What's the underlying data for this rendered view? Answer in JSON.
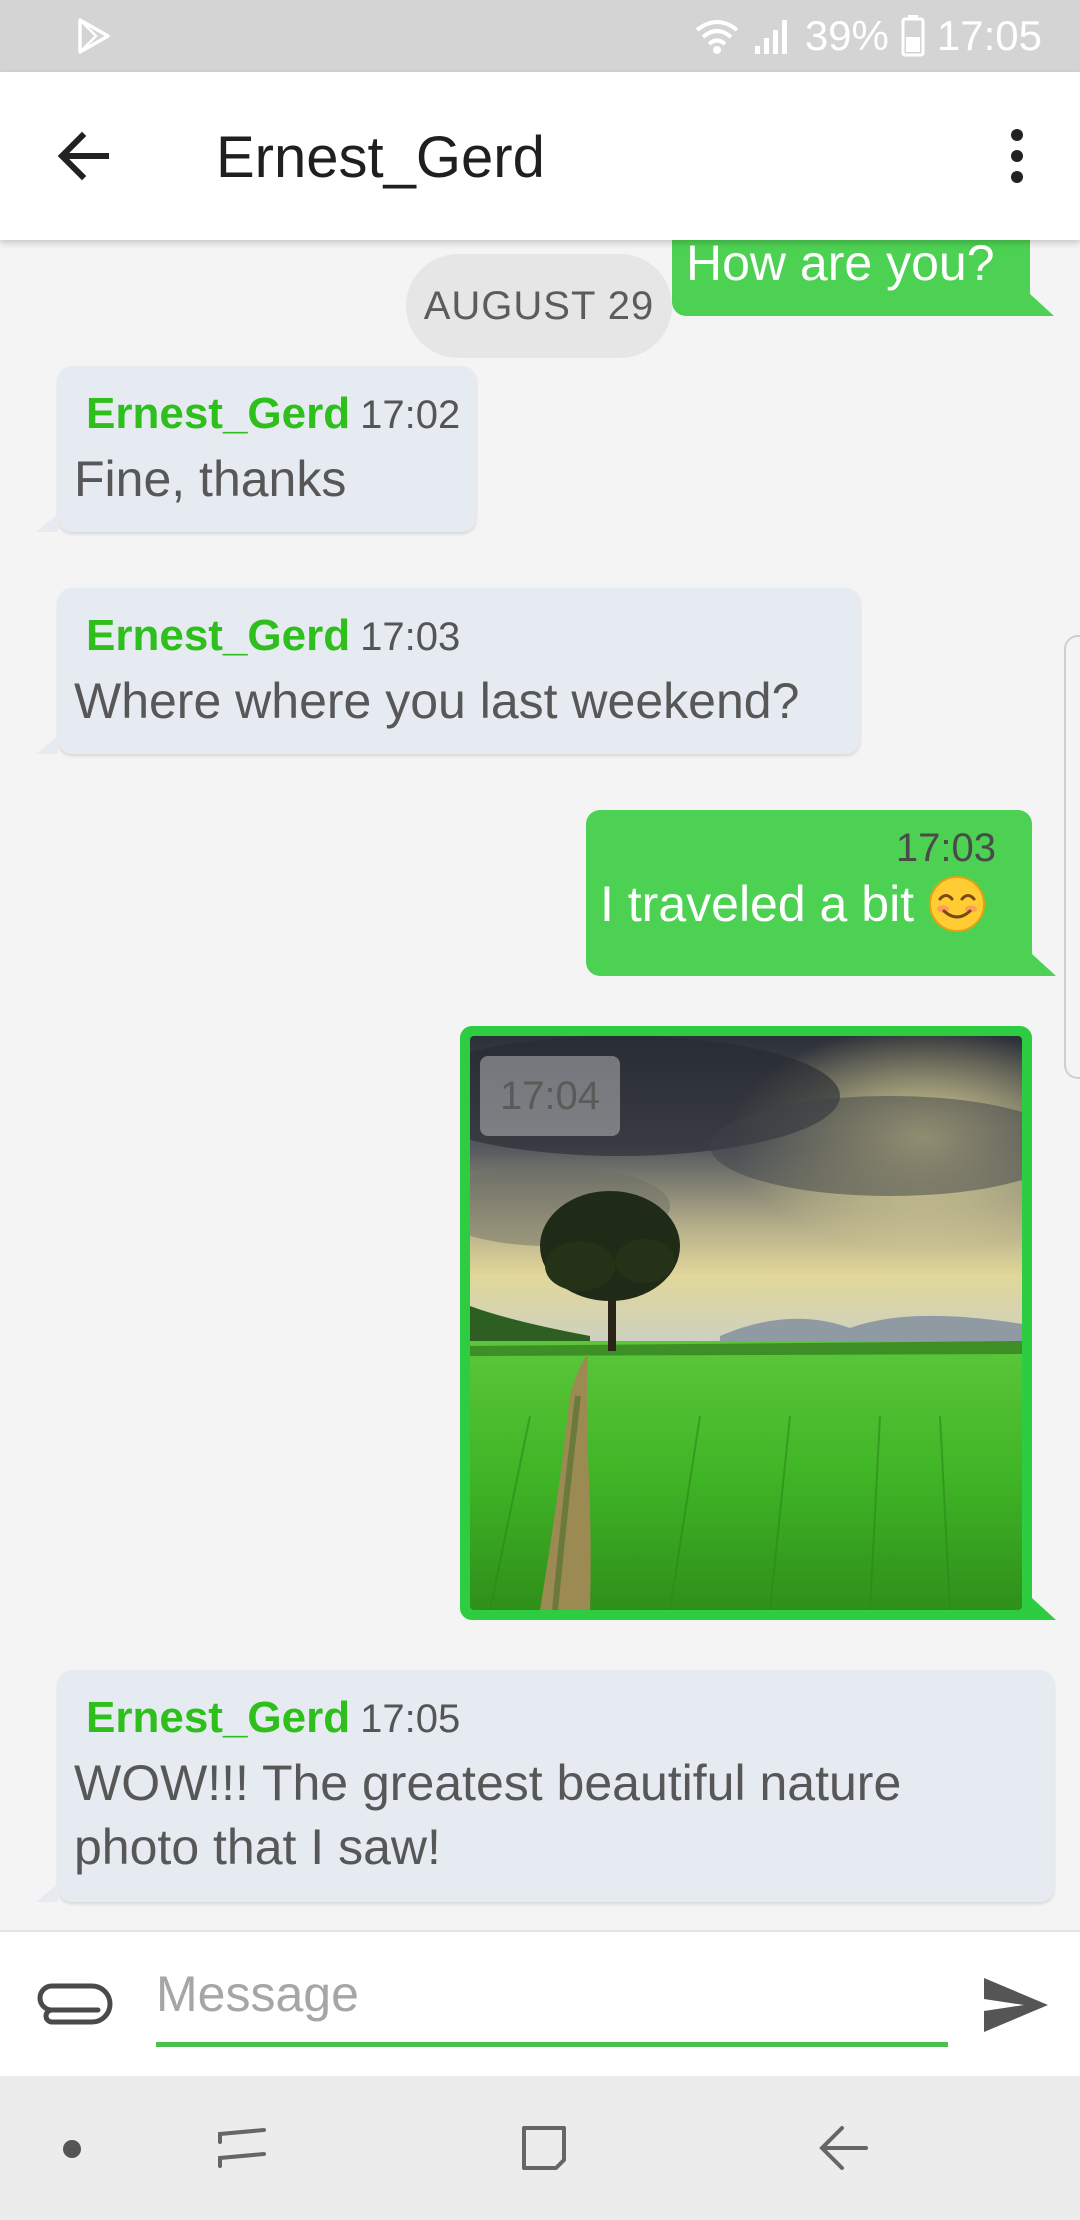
{
  "status_bar": {
    "battery": "39%",
    "time": "17:05",
    "icons": [
      "play-store-icon",
      "wifi-icon",
      "signal-icon",
      "battery-icon"
    ]
  },
  "header": {
    "title": "Ernest_Gerd",
    "icons": [
      "back-arrow-icon",
      "more-vert-icon"
    ]
  },
  "chat": {
    "date_separator": "AUGUST 29",
    "messages": [
      {
        "direction": "outgoing",
        "text": "How are you?"
      },
      {
        "direction": "incoming",
        "sender": "Ernest_Gerd",
        "time": "17:02",
        "text": "Fine, thanks"
      },
      {
        "direction": "incoming",
        "sender": "Ernest_Gerd",
        "time": "17:03",
        "text": "Where where you last weekend?"
      },
      {
        "direction": "outgoing",
        "time": "17:03",
        "text": "I traveled a bit"
      },
      {
        "direction": "outgoing",
        "type": "photo",
        "time": "17:04"
      },
      {
        "direction": "incoming",
        "sender": "Ernest_Gerd",
        "time": "17:05",
        "text": "WOW!!! The greatest beautiful nature photo that I saw!"
      }
    ],
    "emoji": "smiling-face-icon"
  },
  "composer": {
    "placeholder": "Message",
    "value": "",
    "icons": [
      "paperclip-icon",
      "send-icon"
    ]
  },
  "colors": {
    "accent_green": "#4cd152",
    "sender_green": "#2fbf1c",
    "incoming_bubble": "#e6ebf1",
    "background": "#f4f4f4"
  }
}
